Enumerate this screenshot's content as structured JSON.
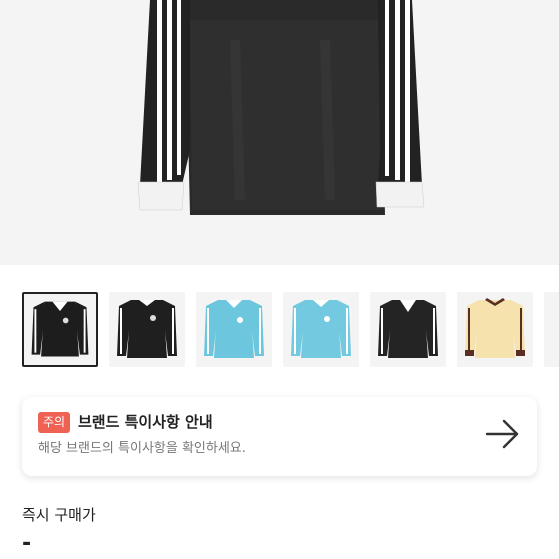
{
  "product": {
    "main_image_icon": "black-long-sleeve-jersey-image",
    "thumbnails": [
      {
        "icon": "black-jersey-white-collar-thumbnail",
        "body_color": "#1d1d1d",
        "accent_color": "#ffffff",
        "active": true
      },
      {
        "icon": "black-jersey-thumbnail",
        "body_color": "#1f1f1f",
        "accent_color": "#ffffff",
        "active": false
      },
      {
        "icon": "sky-blue-jersey-thumbnail",
        "body_color": "#6cc6dd",
        "accent_color": "#ffffff",
        "active": false
      },
      {
        "icon": "sky-blue-jersey-thumbnail-alt",
        "body_color": "#73c9df",
        "accent_color": "#ffffff",
        "active": false
      },
      {
        "icon": "black-jersey-v-neck-thumbnail",
        "body_color": "#242424",
        "accent_color": "#ffffff",
        "active": false
      },
      {
        "icon": "cream-jersey-brown-trim-thumbnail",
        "body_color": "#f6e2ad",
        "accent_color": "#5a2e23",
        "active": false
      }
    ]
  },
  "notice": {
    "badge": "주의",
    "title": "브랜드 특이사항 안내",
    "description": "해당 브랜드의 특이사항을 확인하세요.",
    "arrow_icon": "arrow-right-icon",
    "badge_color": "#ef6253"
  },
  "price": {
    "label": "즉시 구매가",
    "value": "-"
  }
}
